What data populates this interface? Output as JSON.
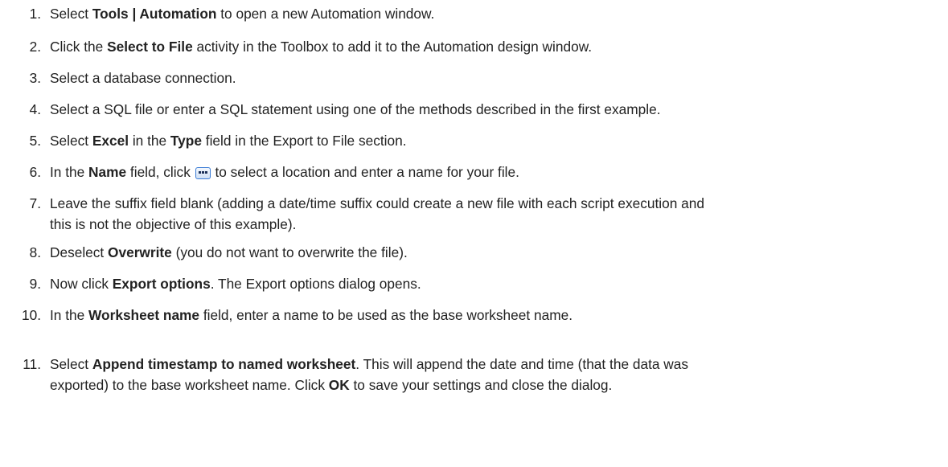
{
  "steps": [
    {
      "num": "1.",
      "parts": [
        {
          "t": "Select "
        },
        {
          "b": "Tools | Automation"
        },
        {
          "t": " to open a new Automation window."
        }
      ]
    },
    {
      "num": "2.",
      "parts": [
        {
          "t": "Click the "
        },
        {
          "b": "Select to File"
        },
        {
          "t": " activity in the Toolbox to add it to the Automation design window."
        }
      ]
    },
    {
      "num": "3.",
      "parts": [
        {
          "t": "Select a database connection."
        }
      ]
    },
    {
      "num": "4.",
      "parts": [
        {
          "t": "Select a SQL file or enter a SQL statement using one of the methods described in the first example."
        }
      ]
    },
    {
      "num": "5.",
      "parts": [
        {
          "t": "Select "
        },
        {
          "b": "Excel"
        },
        {
          "t": " in the "
        },
        {
          "b": "Type"
        },
        {
          "t": " field in the Export to File section."
        }
      ]
    },
    {
      "num": "6.",
      "parts": [
        {
          "t": "In the "
        },
        {
          "b": "Name"
        },
        {
          "t": " field, click "
        },
        {
          "icon": "ellipsis-browse-icon"
        },
        {
          "t": " to select a location and enter a name for your file."
        }
      ]
    },
    {
      "num": "7.",
      "parts": [
        {
          "t": "Leave the suffix field blank (adding a date/time suffix could create a new file with each script execution and"
        },
        {
          "br": true
        },
        {
          "t": "this is not the objective of this example)."
        }
      ]
    },
    {
      "num": "8.",
      "parts": [
        {
          "t": "Deselect "
        },
        {
          "b": "Overwrite"
        },
        {
          "t": " (you do not want to overwrite the file)."
        }
      ]
    },
    {
      "num": "9.",
      "parts": [
        {
          "t": "Now click "
        },
        {
          "b": "Export options"
        },
        {
          "t": ". The Export options dialog opens."
        }
      ]
    },
    {
      "num": "10.",
      "parts": [
        {
          "t": "In the "
        },
        {
          "b": "Worksheet name"
        },
        {
          "t": " field, enter a name to be used as the base worksheet name."
        }
      ]
    },
    {
      "num": "11.",
      "parts": [
        {
          "t": "Select "
        },
        {
          "b": "Append timestamp to named worksheet"
        },
        {
          "t": ". This will append the date and time (that the data was"
        },
        {
          "br": true
        },
        {
          "t": "exported) to the base worksheet name. Click "
        },
        {
          "b": "OK"
        },
        {
          "t": " to save your settings and close the dialog."
        }
      ]
    }
  ]
}
